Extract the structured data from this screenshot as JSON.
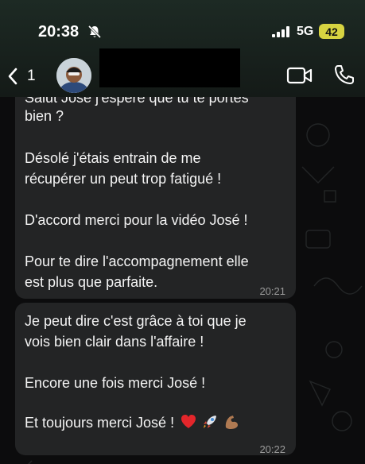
{
  "status_bar": {
    "time": "20:38",
    "network": "5G",
    "battery": "42"
  },
  "header": {
    "back_count": "1"
  },
  "messages": [
    {
      "lines": [
        "Salut José  j'espère que tu te portes",
        "bien ?",
        "Désolé j'étais entrain de me",
        "récupérer un peut trop fatigué !",
        "D'accord merci pour la vidéo José !",
        "Pour te dire l'accompagnement elle",
        "est plus que parfaite."
      ],
      "time": "20:21"
    },
    {
      "lines": [
        "Je peut dire c'est grâce à toi que je",
        "vois bien clair dans l'affaire !",
        "Encore une fois merci José !",
        "Et toujours merci José !"
      ],
      "emojis": [
        "heart",
        "rocket",
        "flexed-biceps"
      ],
      "time": "20:22"
    }
  ],
  "colors": {
    "header_bg": "#1a241f",
    "bubble_bg": "#232425",
    "battery_badge": "#d7d341",
    "timestamp": "#9a9a9a"
  }
}
